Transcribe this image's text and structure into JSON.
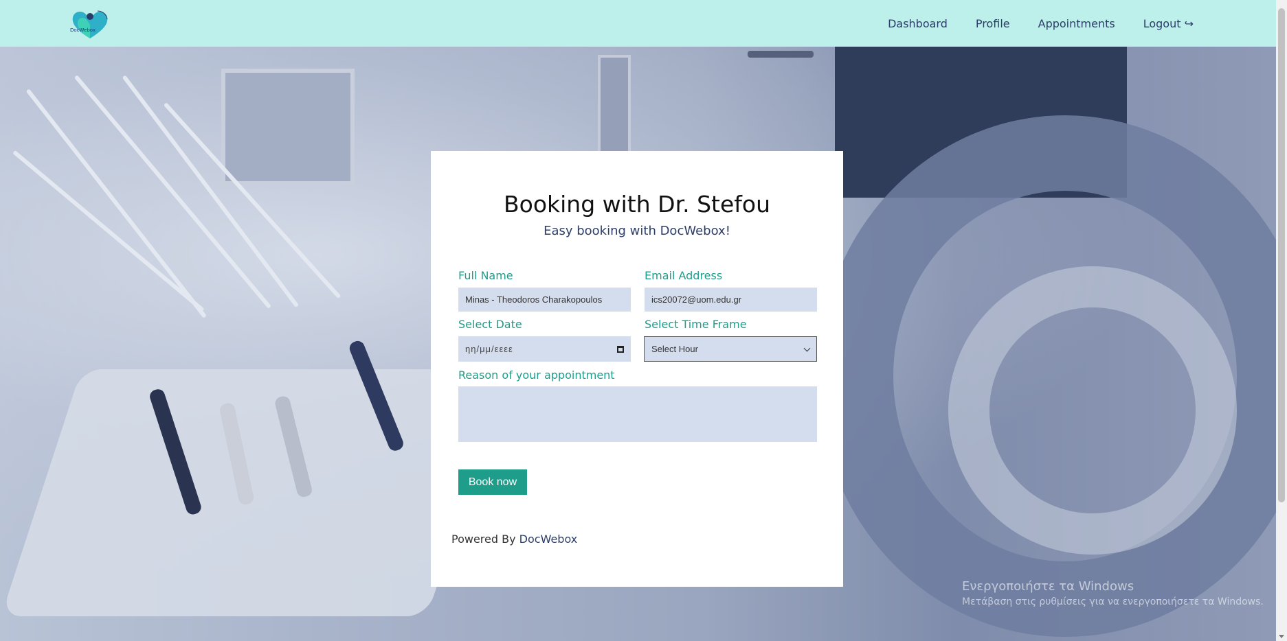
{
  "navbar": {
    "logo_text": "DocWebox",
    "items": [
      {
        "label": "Dashboard"
      },
      {
        "label": "Profile"
      },
      {
        "label": "Appointments"
      },
      {
        "label": "Logout ↪"
      }
    ]
  },
  "card": {
    "title": "Booking with Dr. Stefou",
    "subtitle": "Easy booking with DocWebox!",
    "full_name": {
      "label": "Full Name",
      "value": "Minas - Theodoros Charakopoulos"
    },
    "email": {
      "label": "Email Address",
      "value": "ics20072@uom.edu.gr"
    },
    "date": {
      "label": "Select Date",
      "placeholder": "ηη/μμ/εεεε"
    },
    "time": {
      "label": "Select Time Frame",
      "selected": "Select Hour"
    },
    "reason": {
      "label": "Reason of your appointment",
      "value": ""
    },
    "submit_label": "Book now",
    "powered_prefix": "Powered By",
    "powered_brand": "DocWebox"
  },
  "watermark": {
    "line1": "Ενεργοποιήστε τα Windows",
    "line2": "Μετάβαση στις ρυθμίσεις για να ενεργοποιήσετε τα Windows."
  },
  "colors": {
    "navbar_bg": "#bdf0ea",
    "accent": "#1f9d8b",
    "brand_text": "#2b3d68",
    "field_bg": "#d4ddee"
  },
  "icons": [
    "heart-logo-icon",
    "calendar-icon",
    "chevron-down-icon",
    "logout-arrow-icon"
  ]
}
